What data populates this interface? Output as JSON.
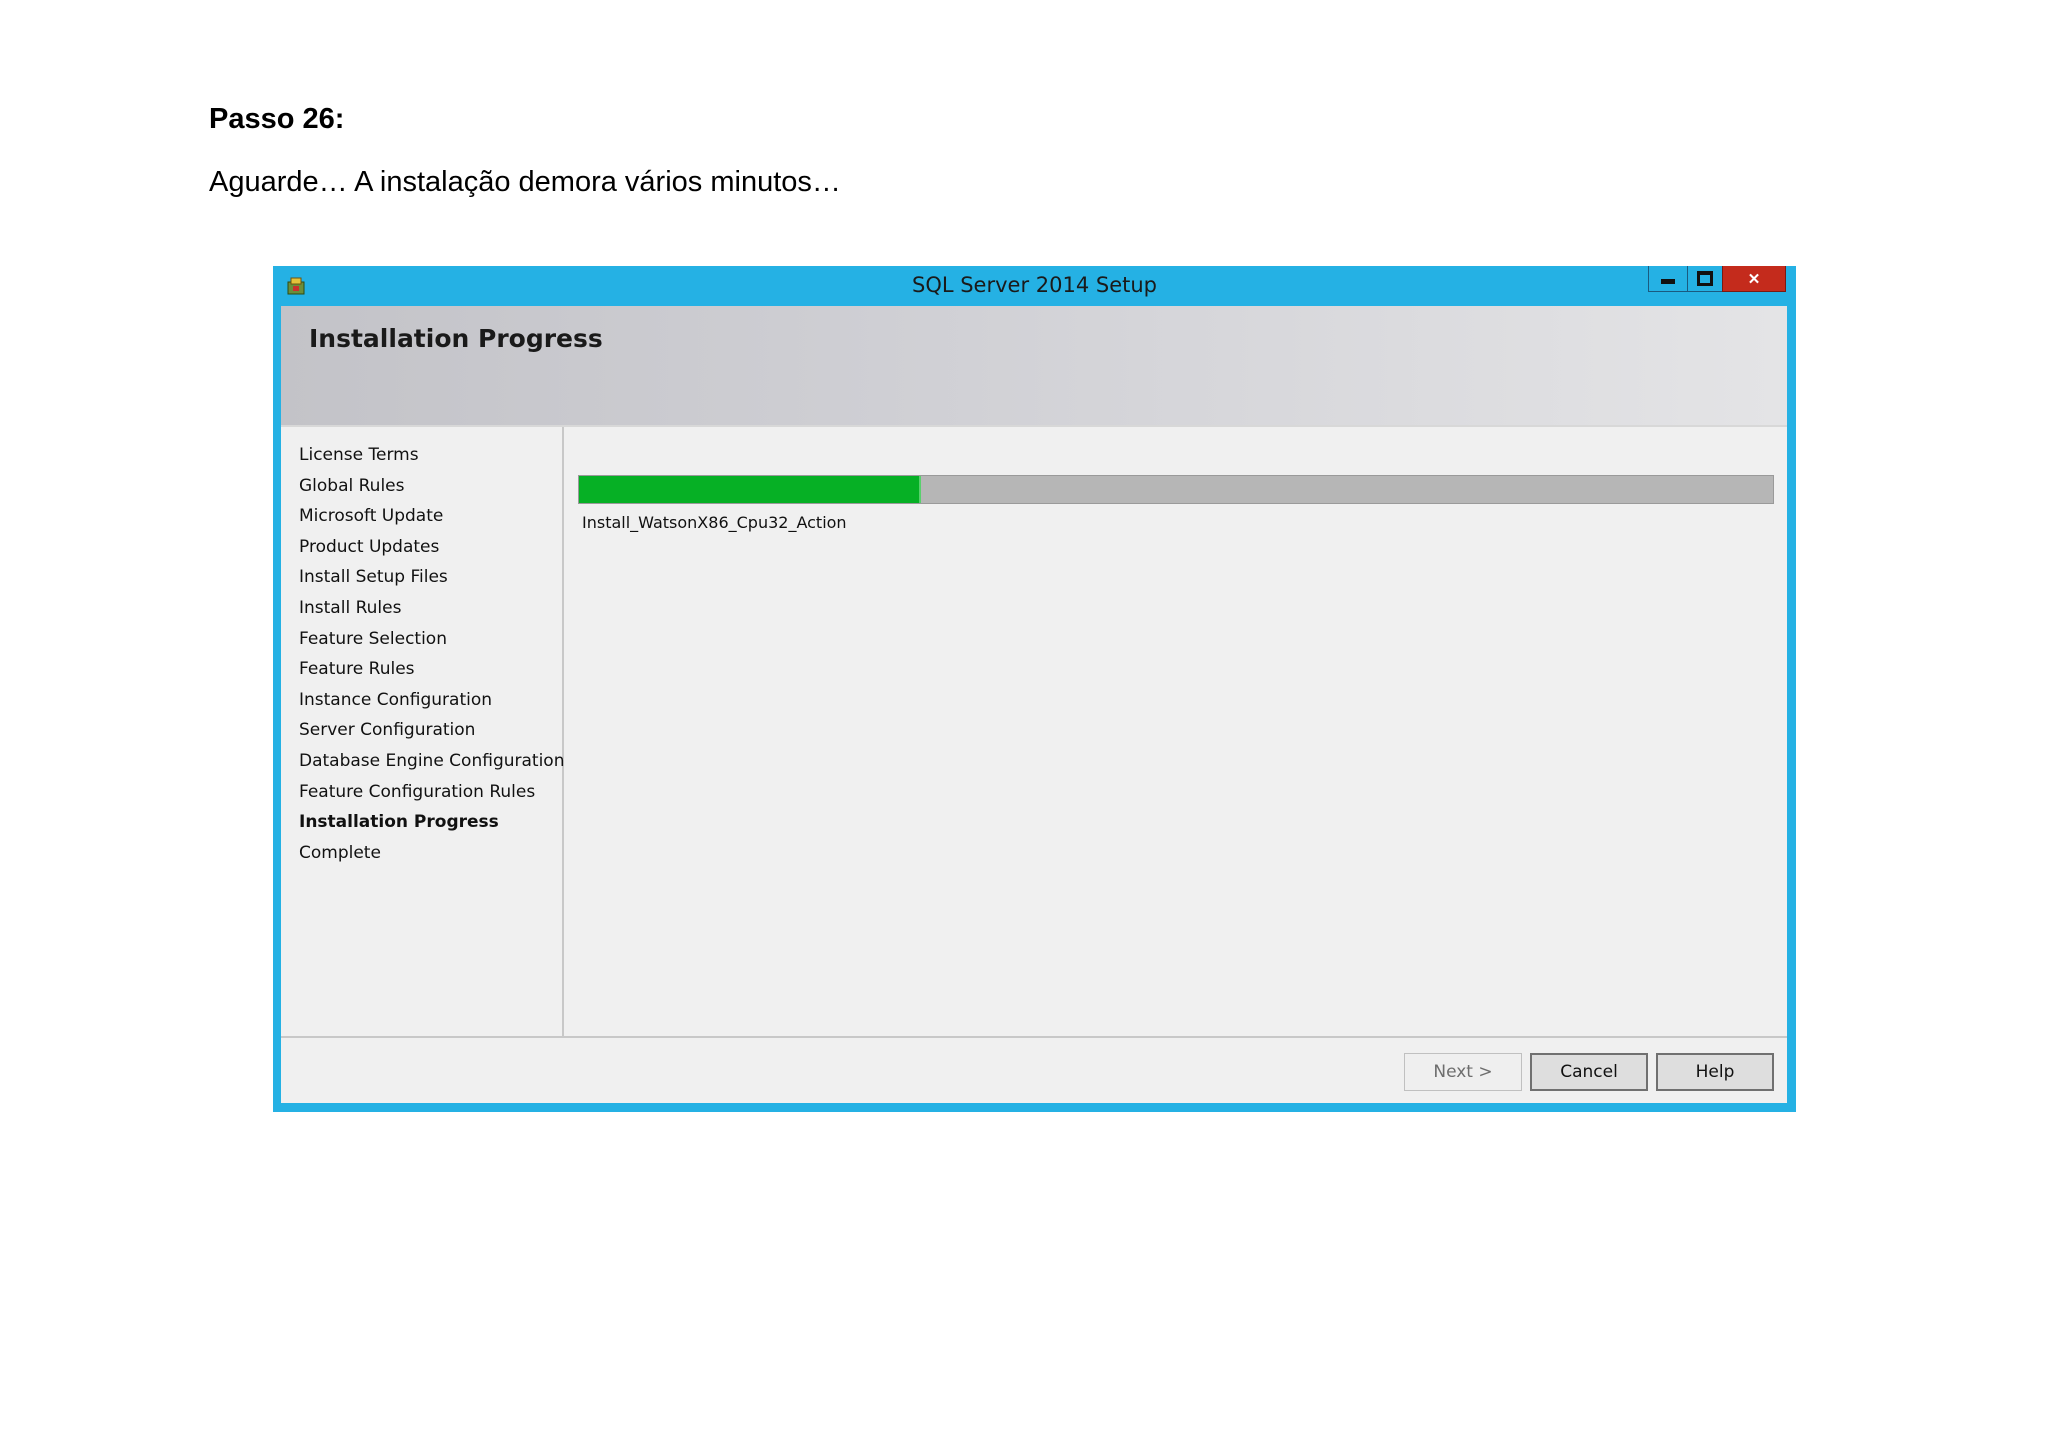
{
  "document": {
    "heading": "Passo 26:",
    "text": "Aguarde… A instalação demora vários minutos…"
  },
  "window": {
    "title": "SQL Server 2014 Setup",
    "controls": {
      "minimize": "minimize-icon",
      "maximize": "maximize-icon",
      "close": "✕"
    }
  },
  "header": {
    "title": "Installation Progress"
  },
  "nav": {
    "items": [
      "License Terms",
      "Global Rules",
      "Microsoft Update",
      "Product Updates",
      "Install Setup Files",
      "Install Rules",
      "Feature Selection",
      "Feature Rules",
      "Instance Configuration",
      "Server Configuration",
      "Database Engine Configuration",
      "Feature Configuration Rules",
      "Installation Progress",
      "Complete"
    ],
    "active_index": 12
  },
  "progress": {
    "fraction": 0.285,
    "status": "Install_WatsonX86_Cpu32_Action",
    "fill_color": "#06b025"
  },
  "buttons": {
    "next": "Next >",
    "cancel": "Cancel",
    "help": "Help"
  },
  "colors": {
    "frame": "#25b1e4",
    "close": "#c42b1c"
  }
}
